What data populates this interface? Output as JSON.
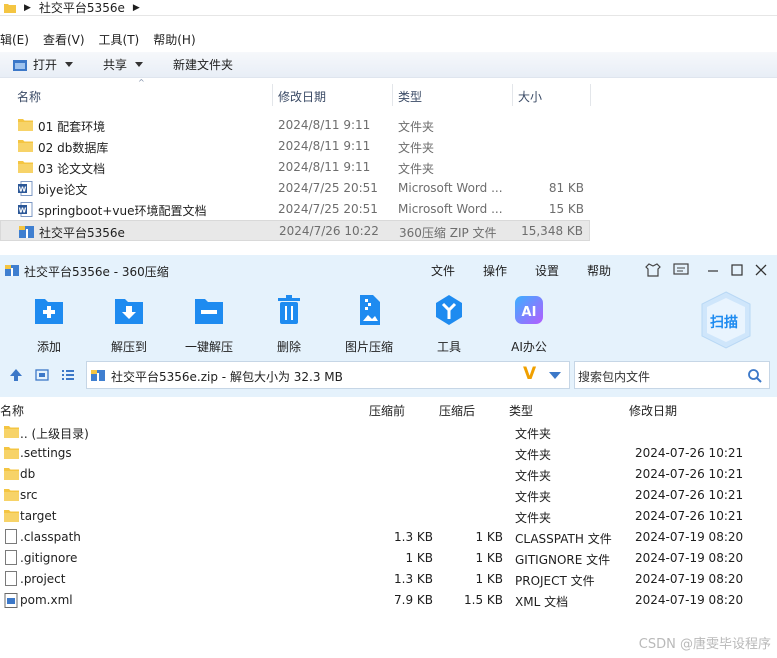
{
  "explorer": {
    "breadcrumb": "社交平台5356e",
    "menu": [
      "辑(E)",
      "查看(V)",
      "工具(T)",
      "帮助(H)"
    ],
    "toolbar": {
      "open": "打开",
      "share": "共享",
      "new_folder": "新建文件夹"
    },
    "columns": {
      "name": "名称",
      "modified": "修改日期",
      "type": "类型",
      "size": "大小"
    },
    "rows": [
      {
        "name": "01 配套环境",
        "date": "2024/8/11 9:11",
        "type": "文件夹",
        "size": "",
        "icon": "folder-icon"
      },
      {
        "name": "02 db数据库",
        "date": "2024/8/11 9:11",
        "type": "文件夹",
        "size": "",
        "icon": "folder-icon"
      },
      {
        "name": "03 论文文档",
        "date": "2024/8/11 9:11",
        "type": "文件夹",
        "size": "",
        "icon": "folder-icon"
      },
      {
        "name": "biye论文",
        "date": "2024/7/25 20:51",
        "type": "Microsoft Word ...",
        "size": "81 KB",
        "icon": "word-doc-icon"
      },
      {
        "name": "springboot+vue环境配置文档",
        "date": "2024/7/25 20:51",
        "type": "Microsoft Word ...",
        "size": "15 KB",
        "icon": "word-doc-icon"
      },
      {
        "name": "社交平台5356e",
        "date": "2024/7/26 10:22",
        "type": "360压缩 ZIP 文件",
        "size": "15,348 KB",
        "icon": "zip-archive-icon"
      }
    ]
  },
  "zip": {
    "title": "社交平台5356e - 360压缩",
    "menu": [
      "文件",
      "操作",
      "设置",
      "帮助"
    ],
    "tools": [
      "添加",
      "解压到",
      "一键解压",
      "删除",
      "图片压缩",
      "工具",
      "AI办公"
    ],
    "scan": "扫描",
    "path": "社交平台5356e.zip - 解包大小为 32.3 MB",
    "search_placeholder": "搜索包内文件",
    "columns": {
      "name": "名称",
      "before": "压缩前",
      "after": "压缩后",
      "type": "类型",
      "modified": "修改日期"
    },
    "rows": [
      {
        "name": ".. (上级目录)",
        "before": "",
        "after": "",
        "type": "文件夹",
        "date": "",
        "icon": "folder-icon"
      },
      {
        "name": ".settings",
        "before": "",
        "after": "",
        "type": "文件夹",
        "date": "2024-07-26 10:21",
        "icon": "folder-icon"
      },
      {
        "name": "db",
        "before": "",
        "after": "",
        "type": "文件夹",
        "date": "2024-07-26 10:21",
        "icon": "folder-icon"
      },
      {
        "name": "src",
        "before": "",
        "after": "",
        "type": "文件夹",
        "date": "2024-07-26 10:21",
        "icon": "folder-icon"
      },
      {
        "name": "target",
        "before": "",
        "after": "",
        "type": "文件夹",
        "date": "2024-07-26 10:21",
        "icon": "folder-icon"
      },
      {
        "name": ".classpath",
        "before": "1.3 KB",
        "after": "1 KB",
        "type": "CLASSPATH 文件",
        "date": "2024-07-19 08:20",
        "icon": "file-icon"
      },
      {
        "name": ".gitignore",
        "before": "1 KB",
        "after": "1 KB",
        "type": "GITIGNORE 文件",
        "date": "2024-07-19 08:20",
        "icon": "file-icon"
      },
      {
        "name": ".project",
        "before": "1.3 KB",
        "after": "1 KB",
        "type": "PROJECT 文件",
        "date": "2024-07-19 08:20",
        "icon": "file-icon"
      },
      {
        "name": "pom.xml",
        "before": "7.9 KB",
        "after": "1.5 KB",
        "type": "XML 文档",
        "date": "2024-07-19 08:20",
        "icon": "xml-file-icon"
      }
    ]
  },
  "watermark": "CSDN @唐雯毕设程序",
  "colors": {
    "accent": "#1e8bf0",
    "panel": "#e5f2fc",
    "folder": "#f4c542"
  }
}
